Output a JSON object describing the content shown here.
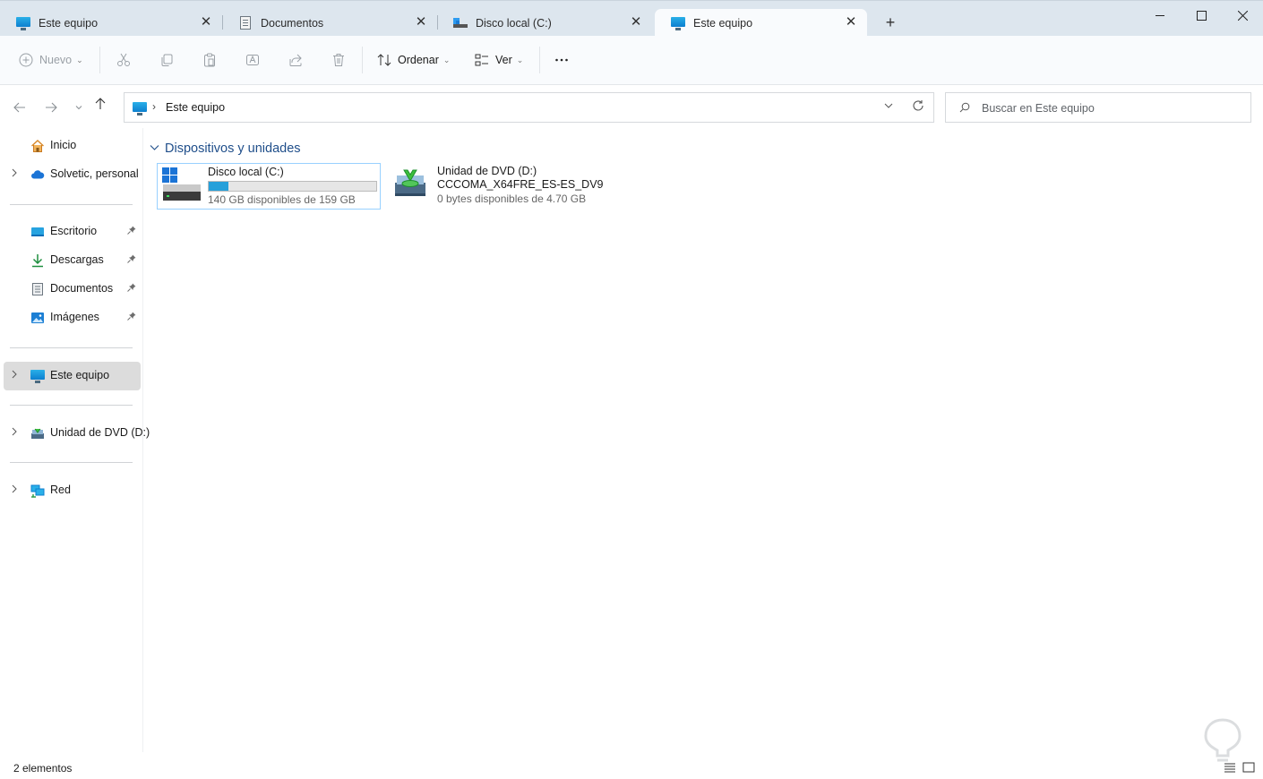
{
  "tabs": [
    {
      "label": "Este equipo",
      "icon": "monitor-icon",
      "active": false
    },
    {
      "label": "Documentos",
      "icon": "document-icon",
      "active": false
    },
    {
      "label": "Disco local (C:)",
      "icon": "drive-icon",
      "active": false
    },
    {
      "label": "Este equipo",
      "icon": "monitor-icon",
      "active": true
    }
  ],
  "toolbar": {
    "new_label": "Nuevo",
    "sort_label": "Ordenar",
    "view_label": "Ver"
  },
  "address": {
    "path": "Este equipo"
  },
  "search": {
    "placeholder": "Buscar en Este equipo"
  },
  "sidebar": {
    "home": "Inicio",
    "onedrive": "Solvetic, personal",
    "pinned": [
      {
        "label": "Escritorio",
        "icon": "desktop-icon"
      },
      {
        "label": "Descargas",
        "icon": "download-icon"
      },
      {
        "label": "Documentos",
        "icon": "document-icon"
      },
      {
        "label": "Imágenes",
        "icon": "pictures-icon"
      }
    ],
    "this_pc": "Este equipo",
    "dvd": "Unidad de DVD (D:)",
    "network": "Red"
  },
  "content": {
    "group_title": "Dispositivos y unidades",
    "drives": [
      {
        "name": "Disco local (C:)",
        "free_text": "140 GB disponibles de 159 GB",
        "used_fraction": 0.12
      },
      {
        "name": "Unidad de DVD (D:)",
        "volume": "CCCOMA_X64FRE_ES-ES_DV9",
        "free_text": "0 bytes disponibles de 4.70 GB"
      }
    ]
  },
  "status": {
    "items_count": "2 elementos"
  },
  "colors": {
    "accent": "#26a0da",
    "group_header": "#1f4e8a",
    "tabbar": "#dde6ee"
  }
}
